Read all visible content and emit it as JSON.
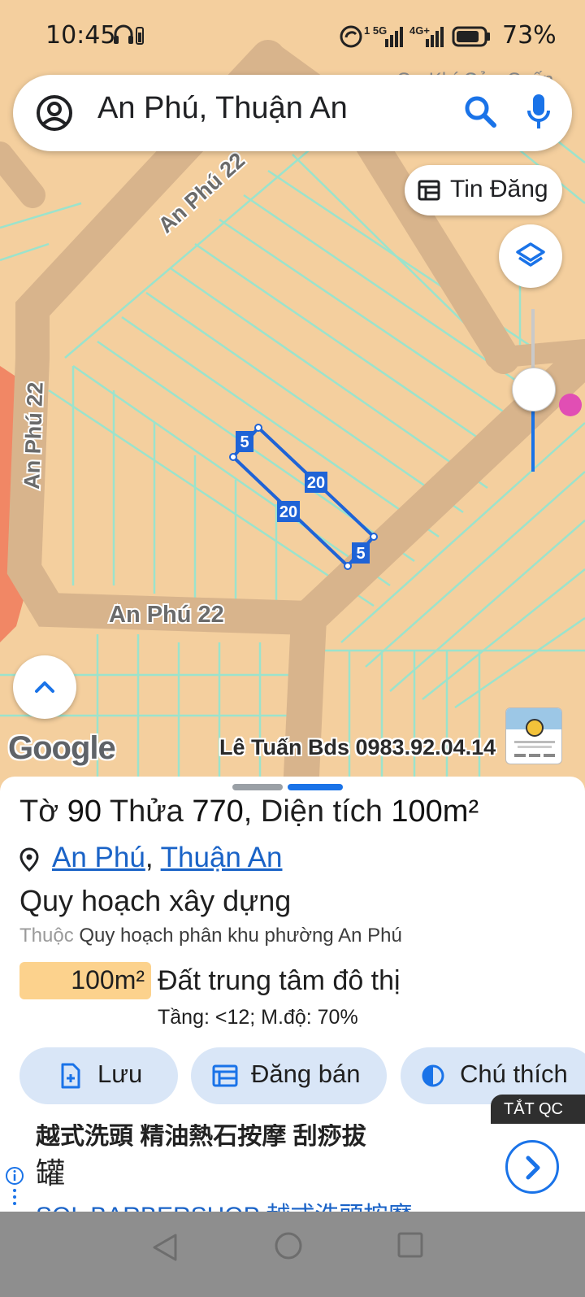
{
  "status": {
    "time": "10:45",
    "battery": "73%",
    "signal1": "1 5G",
    "signal2": "4G+"
  },
  "search": {
    "text": "An Phú, Thuận An"
  },
  "map": {
    "tin_dang": "Tin Đăng",
    "road_top": "An Phú 22",
    "road_left": "An Phú 22",
    "road_bottom": "An Phú 22",
    "poi_partial": "Cơ Khí Cửa Cuốn",
    "dim_5a": "5",
    "dim_20a": "20",
    "dim_20b": "20",
    "dim_5b": "5",
    "google": "Google",
    "watermark": "Lê Tuấn Bds 0983.92.04.14"
  },
  "parcel": {
    "label_to": "Tờ",
    "to": "90",
    "label_thua": "Thửa",
    "thua": "770",
    "label_area": "Diện tích",
    "area": "100m²",
    "ward": "An Phú",
    "city": "Thuận An",
    "plan_heading": "Quy hoạch xây dựng",
    "belongs_label": "Thuộc",
    "plan_name": "Quy hoạch phân khu phường An Phú",
    "zone_area": "100m²",
    "zone_name": "Đất trung tâm đô thị",
    "zone_detail": "Tầng: <12; M.độ: 70%"
  },
  "actions": {
    "save": "Lưu",
    "post_sale": "Đăng bán",
    "legend": "Chú thích"
  },
  "ad": {
    "off_label": "TẮT QC",
    "line1": "越式洗頭 精油熱石按摩 刮痧拔",
    "line2": "罐",
    "line3": "SOL BARBERSHOP 越式洗頭按摩"
  }
}
